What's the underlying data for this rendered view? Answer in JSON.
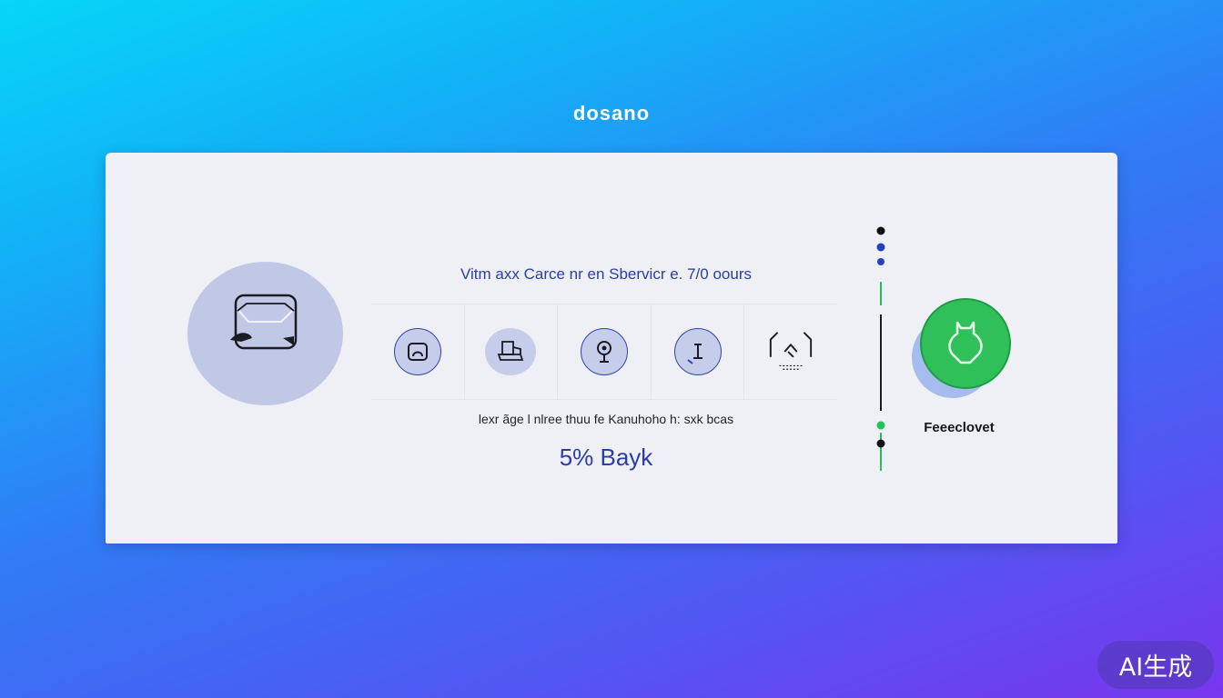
{
  "brand": {
    "logo_text": "dosano"
  },
  "main_card": {
    "headline": "Vitm axx Carce nr en Sbervicr e. 7/0 oours",
    "subline": "lexr ãge l nlree thuu fe Kanuhoho h: sxk bcas",
    "price": "5% Bayk",
    "hero_icon": "chat-bubble-icon",
    "features": [
      {
        "icon": "message-icon",
        "style": "outline"
      },
      {
        "icon": "box-icon",
        "style": "soft"
      },
      {
        "icon": "location-pin-icon",
        "style": "outline"
      },
      {
        "icon": "info-icon",
        "style": "soft"
      },
      {
        "icon": "house-icon",
        "style": "plain"
      }
    ]
  },
  "action": {
    "label": "Feeeclovet",
    "icon": "shield-icon",
    "color": "#2fc05a"
  },
  "timeline": {
    "dot_colors": [
      "#111111",
      "#2540c4",
      "#2540c4",
      "#22c35a",
      "#111111"
    ]
  },
  "badge": {
    "text": "AI生成"
  },
  "colors": {
    "background_start": "#06d6f7",
    "background_end": "#7936ee",
    "accent_blue": "#2a3da8",
    "accent_green": "#2fc05a",
    "card_background": "#eef0f5"
  }
}
